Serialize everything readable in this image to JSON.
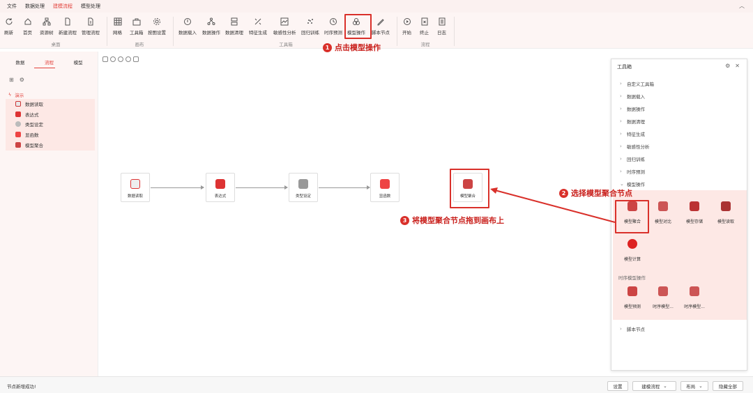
{
  "menubar": {
    "items": [
      "文件",
      "数据处理",
      "建模流程",
      "模型处理"
    ],
    "active_index": 2
  },
  "ribbon": {
    "buttons": [
      "刷新",
      "首页",
      "资源树",
      "新建流程",
      "管理流程",
      "网格",
      "工具箱",
      "按图设置",
      "数据载入",
      "数据操作",
      "数据清理",
      "特征生成",
      "敏感性分析",
      "回归训练",
      "时序预测",
      "模型操作",
      "脚本节点",
      "开始",
      "终止",
      "日志"
    ],
    "groups": [
      "桌面",
      "画布",
      "工具箱",
      "流程"
    ]
  },
  "left_panel": {
    "tabs": [
      "数据",
      "流程",
      "模型"
    ],
    "active_tab": 1,
    "root": "演示",
    "items": [
      "数据读取",
      "表达式",
      "类型设定",
      "显函数",
      "模型聚合"
    ]
  },
  "canvas": {
    "nodes": [
      "数据读取",
      "表达式",
      "类型设定",
      "显函数",
      "模型聚合"
    ]
  },
  "annotations": {
    "step1": {
      "num": "1",
      "text": "点击模型操作"
    },
    "step2": {
      "num": "2",
      "text": "选择模型聚合节点"
    },
    "step3": {
      "num": "3",
      "text": "将模型聚合节点拖到画布上"
    }
  },
  "toolbox": {
    "title": "工具箱",
    "categories": [
      "自定义工具箱",
      "数据载入",
      "数据操作",
      "数据清理",
      "特征生成",
      "敏感性分析",
      "回归训练",
      "时序预测",
      "模型操作"
    ],
    "expanded": "模型操作",
    "model_ops": [
      "模型聚合",
      "模型对比",
      "模型存储",
      "模型读取",
      "模型计算"
    ],
    "ts_header": "时序模型操作",
    "ts_ops": [
      "模型预测",
      "时序模型...",
      "时序模型..."
    ],
    "last_category": "脚本节点"
  },
  "status": {
    "message": "节点新增成功!",
    "buttons": [
      "设置",
      "建模流程",
      "布局",
      "隐藏全部"
    ]
  },
  "colors": {
    "accent": "#e2413b",
    "annotation": "#d9302a",
    "panel_bg": "#fdf5f4",
    "highlight_bg": "#fde8e5"
  }
}
